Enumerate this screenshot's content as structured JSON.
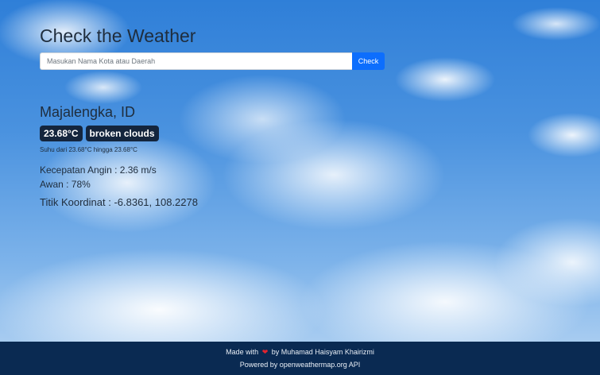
{
  "header": {
    "title": "Check the Weather"
  },
  "search": {
    "placeholder": "Masukan Nama Kota atau Daerah",
    "value": "",
    "button_label": "Check"
  },
  "weather": {
    "city": "Majalengka, ID",
    "temperature": "23.68°C",
    "description": "broken clouds",
    "range": "Suhu dari 23.68°C hingga 23.68°C",
    "wind": "Kecepatan Angin : 2.36 m/s",
    "clouds": "Awan : 78%",
    "coordinates": "Titik Koordinat : -6.8361, 108.2278"
  },
  "footer": {
    "made_with": "Made with",
    "author": "by Muhamad Haisyam Khairizmi",
    "powered": "Powered by openweathermap.org API",
    "heart_icon": "heart-icon",
    "heart_color": "#e0242f"
  },
  "colors": {
    "accent": "#0d6efd",
    "badge_bg": "#14253d",
    "footer_bg": "#0a2a52"
  }
}
